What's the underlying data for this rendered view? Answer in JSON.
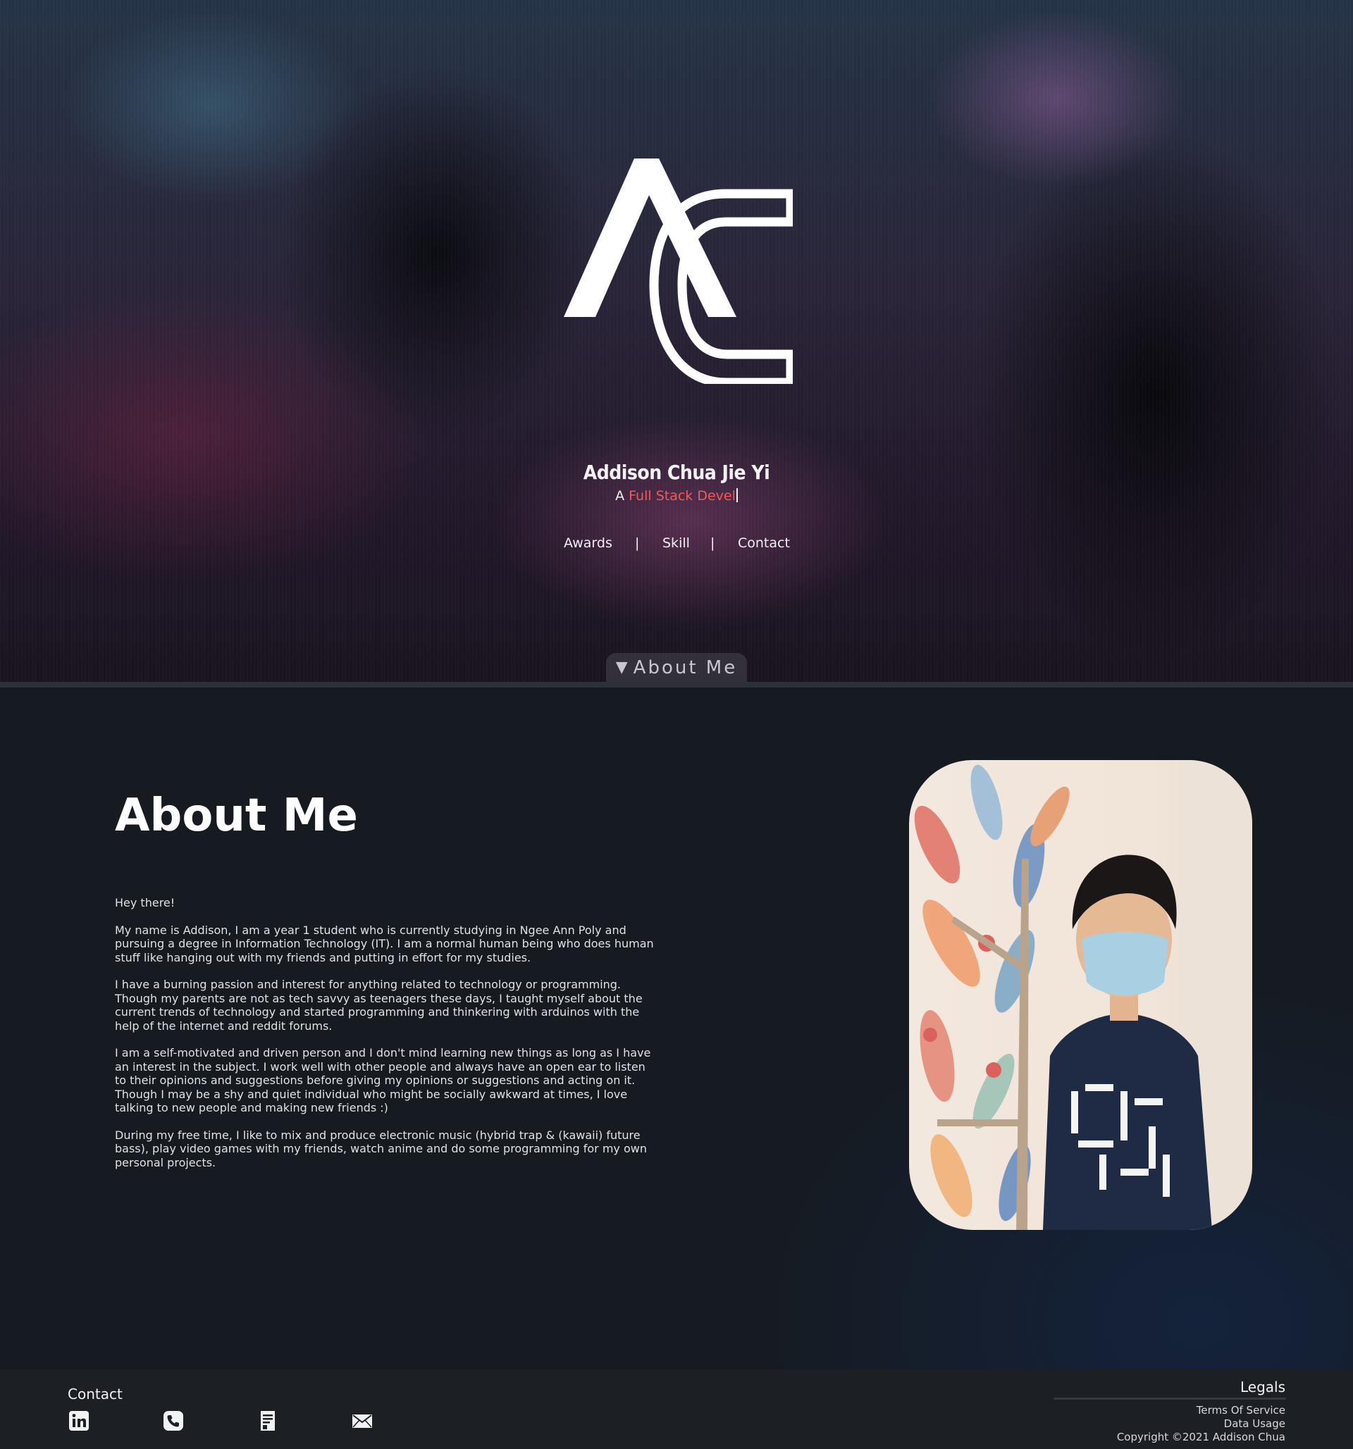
{
  "hero": {
    "logo_name": "AC monogram logo",
    "name": "Addison Chua Jie Yi",
    "tagline_prefix": "A",
    "tagline_role": "Full Stack Devel",
    "nav": [
      "Awards",
      "Skill",
      "Contact"
    ],
    "nav_separator": "|",
    "scroll_tab": "About Me",
    "scroll_tab_icon": "triangle-down-icon"
  },
  "about": {
    "title": "About Me",
    "paragraphs": [
      "Hey there!",
      "My name is Addison, I am a year 1 student who is currently studying in Ngee Ann Poly and pursuing a degree in Information Technology (IT). I am a normal human being who does human stuff like hanging out with my friends and putting in effort for my studies.",
      "I have a burning passion and interest for anything related to technology or programming. Though my parents are not as tech savvy as teenagers these days, I taught myself about the current trends of technology and started programming and thinkering with arduinos with the help of the internet and reddit forums.",
      "I am a self-motivated and driven person and I don't mind learning new things as long as I have an interest in the subject. I work well with other people and always have an open ear to listen to their opinions and suggestions before giving my opinions or suggestions and acting on it. Though I may be a shy and quiet individual who might be socially awkward at times, I love talking to new people and making new friends :)",
      "During my free time, I like to mix and produce electronic music (hybrid trap & (kawaii) future bass), play video games with my friends, watch anime and do some programming for my own personal projects."
    ],
    "photo_alt": "portrait-photo"
  },
  "footer": {
    "contact_title": "Contact",
    "contact_icons": [
      "linkedin-icon",
      "phone-icon",
      "resume-icon",
      "mail-icon"
    ],
    "legals_title": "Legals",
    "legals": [
      "Terms Of Service",
      "Data Usage",
      "Copyright ©2021 Addison Chua"
    ]
  },
  "colors": {
    "accent": "#ef5b5b",
    "background": "#161b22",
    "footer": "#1c1f24"
  }
}
